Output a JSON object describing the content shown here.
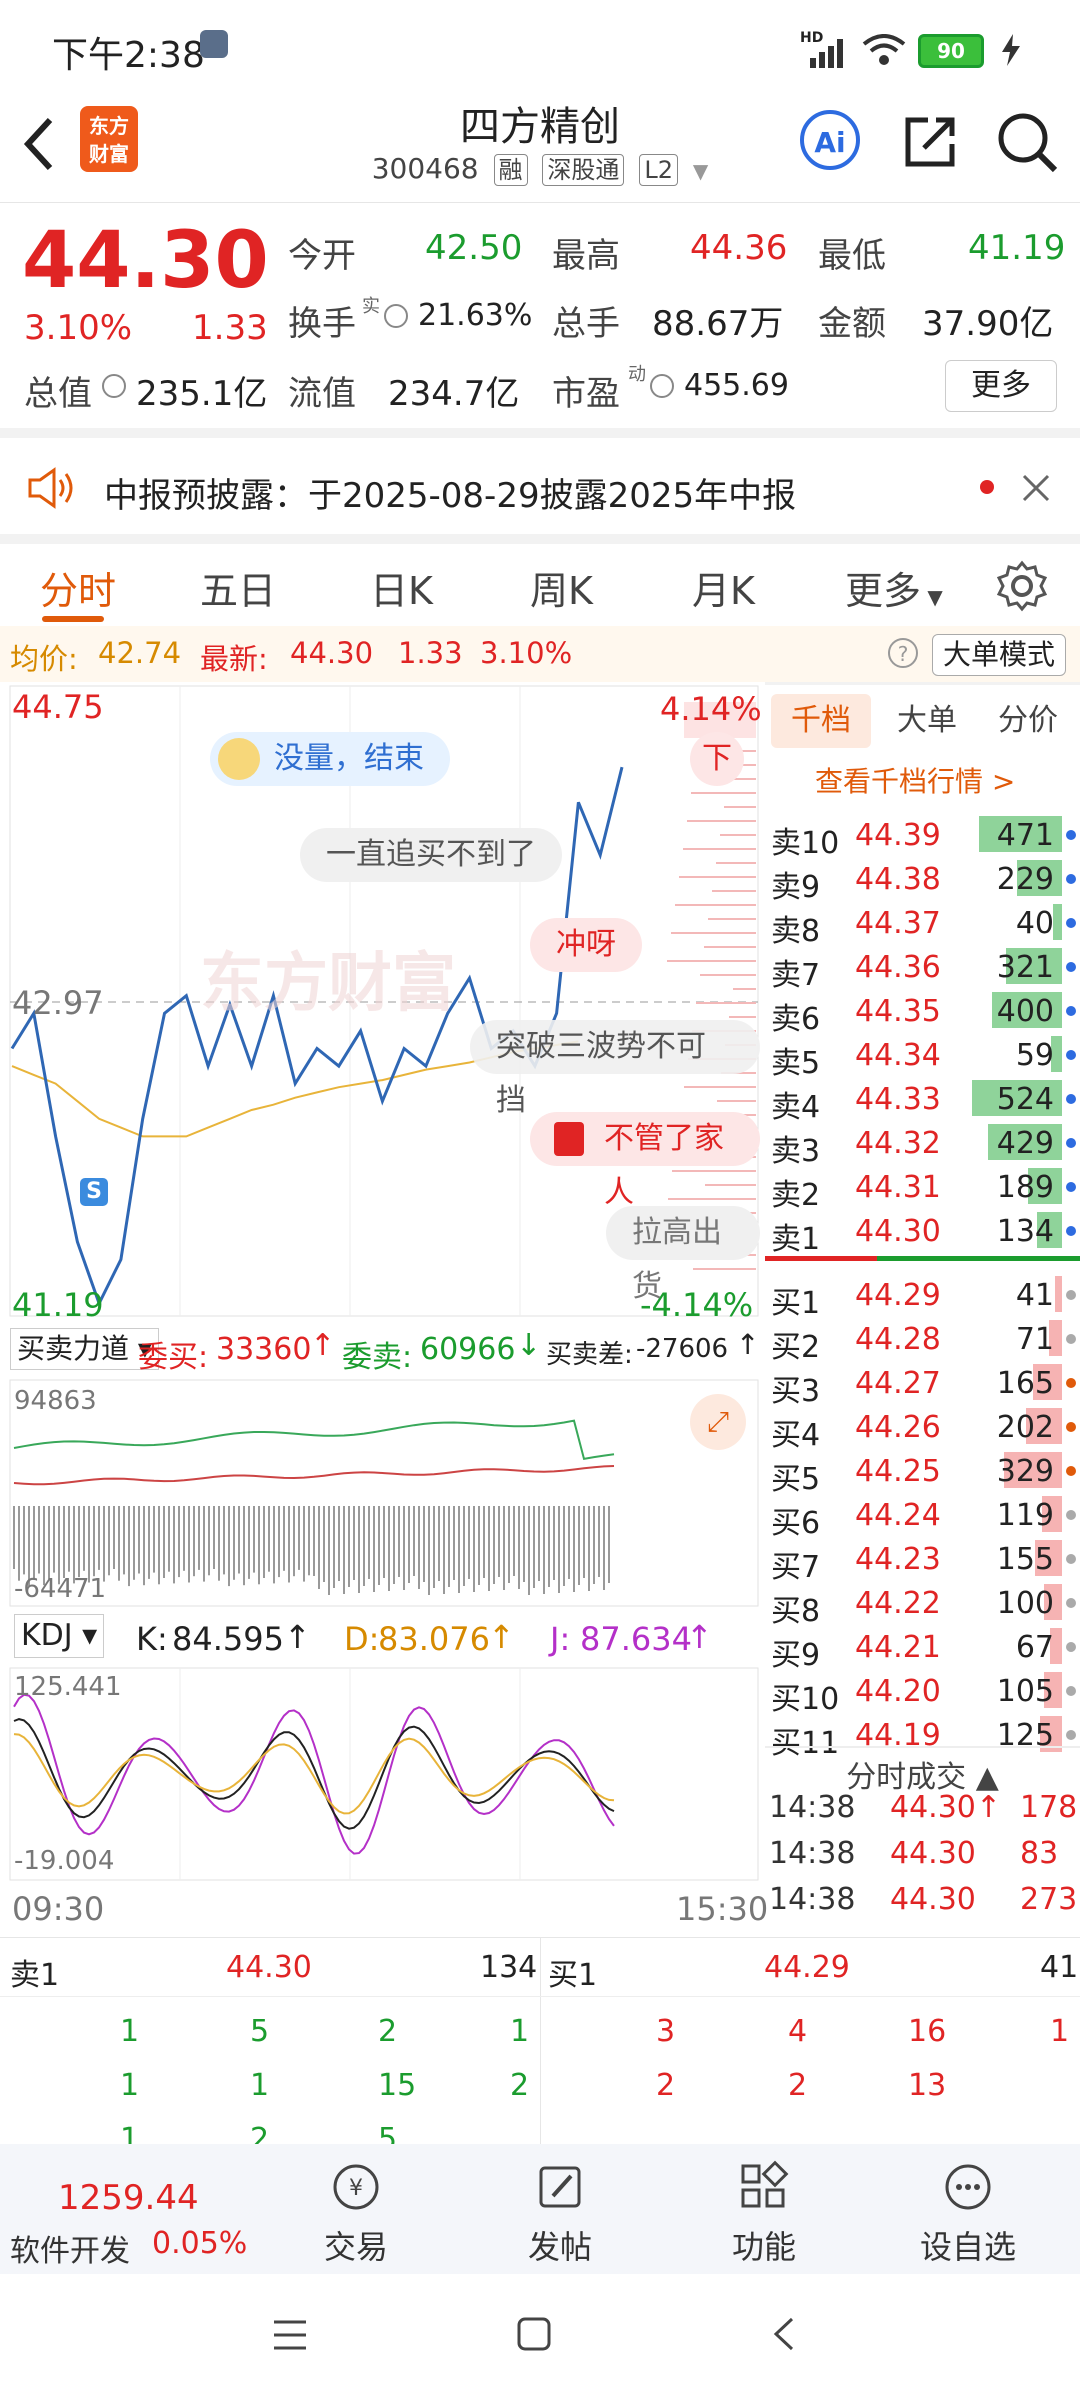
{
  "status_bar": {
    "time": "下午2:38",
    "battery": "90",
    "signal_label": "HD"
  },
  "header": {
    "logo_lines": [
      "东方",
      "财富"
    ],
    "title": "四方精创",
    "code": "300468",
    "tags": [
      "融",
      "深股通",
      "L2"
    ],
    "ai_label": "Ai"
  },
  "quote": {
    "price": "44.30",
    "change_pct": "3.10%",
    "change": "1.33",
    "open_label": "今开",
    "open": "42.50",
    "high_label": "最高",
    "high": "44.36",
    "low_label": "最低",
    "low": "41.19",
    "turnover_label": "换手",
    "turnover_sup": "实",
    "turnover": "21.63%",
    "volume_label": "总手",
    "volume": "88.67万",
    "amount_label": "金额",
    "amount": "37.90亿",
    "mktcap_label": "总值",
    "mktcap": "235.1亿",
    "float_label": "流值",
    "float": "234.7亿",
    "pe_label": "市盈",
    "pe_sup": "动",
    "pe": "455.69",
    "more": "更多"
  },
  "notice": {
    "text": "中报预披露：于2025-08-29披露2025年中报"
  },
  "tabs": [
    "分时",
    "五日",
    "日K",
    "周K",
    "月K",
    "更多"
  ],
  "info_line": {
    "avg_label": "均价:",
    "avg": "42.74",
    "latest_label": "最新:",
    "latest": "44.30",
    "change": "1.33",
    "change_pct": "3.10%",
    "mode": "大单模式"
  },
  "chart": {
    "y_top": "44.75",
    "y_mid": "42.97",
    "y_bottom": "41.19",
    "pct_top": "4.14%",
    "pct_bottom": "-4.14%",
    "time_start": "09:30",
    "time_end": "15:30",
    "comments": [
      "没量，结束",
      "一直追买不到了",
      "冲呀",
      "突破三波势不可挡",
      "不管了家人",
      "拉高出货",
      "下"
    ],
    "s_marker": "S",
    "watermark": "东方财富"
  },
  "chart_data": {
    "type": "line",
    "series": [
      {
        "name": "均价",
        "color": "#e8b43a",
        "values": [
          42.6,
          42.55,
          42.5,
          42.4,
          42.3,
          42.25,
          42.2,
          42.2,
          42.2,
          42.25,
          42.3,
          42.35,
          42.38,
          42.42,
          42.45,
          42.48,
          42.5,
          42.52,
          42.55,
          42.58,
          42.6,
          42.62,
          42.65,
          42.68,
          42.7,
          42.72,
          42.74
        ]
      },
      {
        "name": "价格",
        "color": "#2f67b4",
        "values": [
          42.7,
          42.9,
          42.2,
          41.6,
          41.25,
          41.5,
          42.3,
          42.9,
          43.0,
          42.6,
          42.95,
          42.6,
          43.0,
          42.5,
          42.7,
          42.6,
          42.8,
          42.4,
          42.7,
          42.6,
          42.9,
          43.1,
          42.7,
          42.8,
          42.6,
          42.9,
          44.1,
          43.8,
          44.3
        ]
      }
    ],
    "y_range": [
      41.19,
      44.75
    ]
  },
  "auction": {
    "label": "买卖力道",
    "bid_label": "委买:",
    "bid": "33360",
    "ask_label": "委卖:",
    "ask": "60966",
    "diff_label": "买卖差:",
    "diff": "-27606",
    "y_top": "94863",
    "y_bottom": "-64471"
  },
  "kdj": {
    "label": "KDJ",
    "k_label": "K:",
    "k": "84.595",
    "d_label": "D:",
    "d": "83.076",
    "j_label": "J:",
    "j": "87.634",
    "y_top": "125.441",
    "y_bottom": "-19.004"
  },
  "book": {
    "tabs": [
      "千档",
      "大单",
      "分价"
    ],
    "link": "查看千档行情 >",
    "asks": [
      {
        "label": "卖10",
        "price": "44.39",
        "vol": "471",
        "bar": 0.92
      },
      {
        "label": "卖9",
        "price": "44.38",
        "vol": "229",
        "bar": 0.5
      },
      {
        "label": "卖8",
        "price": "44.37",
        "vol": "40",
        "bar": 0.1
      },
      {
        "label": "卖7",
        "price": "44.36",
        "vol": "321",
        "bar": 0.62
      },
      {
        "label": "卖6",
        "price": "44.35",
        "vol": "400",
        "bar": 0.78
      },
      {
        "label": "卖5",
        "price": "44.34",
        "vol": "59",
        "bar": 0.12
      },
      {
        "label": "卖4",
        "price": "44.33",
        "vol": "524",
        "bar": 1.0
      },
      {
        "label": "卖3",
        "price": "44.32",
        "vol": "429",
        "bar": 0.82
      },
      {
        "label": "卖2",
        "price": "44.31",
        "vol": "189",
        "bar": 0.38
      },
      {
        "label": "卖1",
        "price": "44.30",
        "vol": "134",
        "bar": 0.28
      }
    ],
    "bids": [
      {
        "label": "买1",
        "price": "44.29",
        "vol": "41",
        "bar": 0.08
      },
      {
        "label": "买2",
        "price": "44.28",
        "vol": "71",
        "bar": 0.14
      },
      {
        "label": "买3",
        "price": "44.27",
        "vol": "165",
        "bar": 0.32
      },
      {
        "label": "买4",
        "price": "44.26",
        "vol": "202",
        "bar": 0.4
      },
      {
        "label": "买5",
        "price": "44.25",
        "vol": "329",
        "bar": 0.64
      },
      {
        "label": "买6",
        "price": "44.24",
        "vol": "119",
        "bar": 0.22
      },
      {
        "label": "买7",
        "price": "44.23",
        "vol": "155",
        "bar": 0.3
      },
      {
        "label": "买8",
        "price": "44.22",
        "vol": "100",
        "bar": 0.2
      },
      {
        "label": "买9",
        "price": "44.21",
        "vol": "67",
        "bar": 0.13
      },
      {
        "label": "买10",
        "price": "44.20",
        "vol": "105",
        "bar": 0.2
      },
      {
        "label": "买11",
        "price": "44.19",
        "vol": "125",
        "bar": 0.24
      }
    ],
    "trades_title": "分时成交",
    "trades": [
      {
        "time": "14:38",
        "price": "44.30↑",
        "vol": "178"
      },
      {
        "time": "14:38",
        "price": "44.30",
        "vol": "83"
      },
      {
        "time": "14:38",
        "price": "44.30",
        "vol": "273"
      }
    ]
  },
  "queue": {
    "sell_label": "卖1",
    "sell_price": "44.30",
    "sell_vol": "134",
    "buy_label": "买1",
    "buy_price": "44.29",
    "buy_vol": "41",
    "sell_rows": [
      [
        "1",
        "5",
        "2",
        "1"
      ],
      [
        "1",
        "1",
        "15",
        "2"
      ],
      [
        "1",
        "2",
        "5",
        "..."
      ]
    ],
    "buy_rows": [
      [
        "3",
        "4",
        "16",
        "1"
      ],
      [
        "2",
        "2",
        "13",
        ""
      ]
    ]
  },
  "footer": {
    "index_value": "1259.44",
    "index_name": "软件开发",
    "index_change": "0.05%",
    "items": [
      "交易",
      "发帖",
      "功能",
      "设自选"
    ]
  }
}
